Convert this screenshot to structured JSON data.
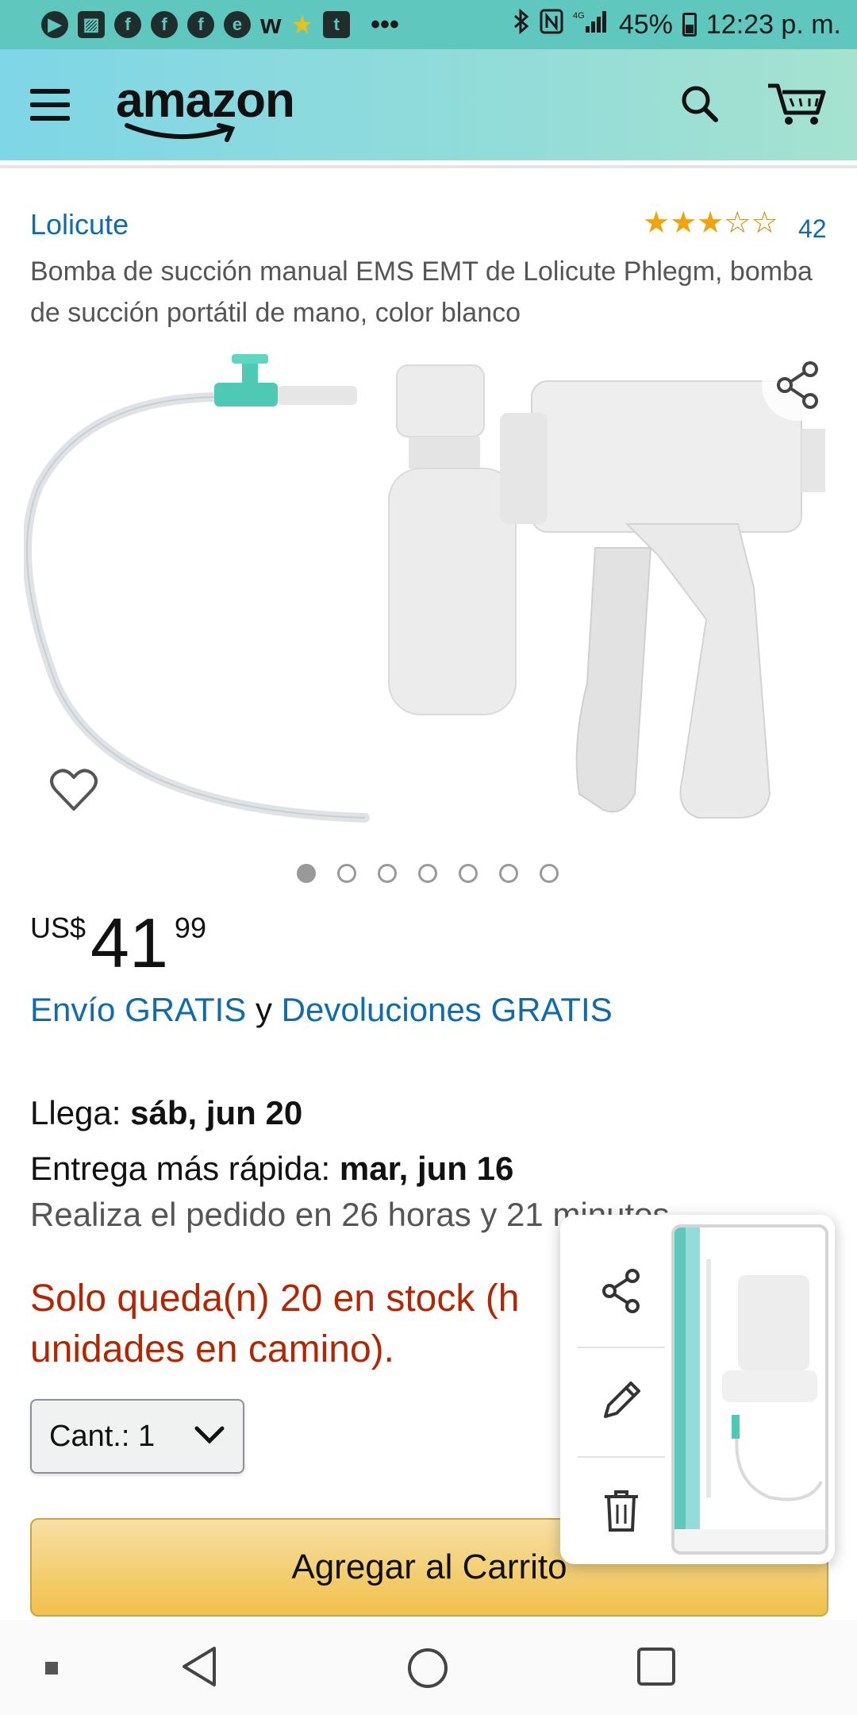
{
  "status_bar": {
    "app_icons": [
      "P",
      "img",
      "f",
      "f",
      "f",
      "e",
      "w",
      "star",
      "t"
    ],
    "more": "•••",
    "battery": "45%",
    "time": "12:23 p. m."
  },
  "header": {
    "logo": "amazon",
    "menu_icon": "hamburger-icon",
    "search_icon": "search-icon",
    "cart_icon": "cart-icon"
  },
  "product": {
    "brand": "Lolicute",
    "rating_stars": 3.5,
    "rating_count": "42",
    "title": "Bomba de succión manual EMS EMT de Lolicute Phlegm, bomba de succión portátil de mano, color blanco",
    "image_count": 7,
    "active_image": 1
  },
  "price": {
    "currency": "US$",
    "whole": "41",
    "fraction": "99"
  },
  "shipping": {
    "free_shipping": "Envío GRATIS",
    "connector": " y ",
    "free_returns": "Devoluciones GRATIS"
  },
  "delivery": {
    "arrive_label": "Llega: ",
    "arrive_date": "sáb, jun 20",
    "fastest_label": "Entrega más rápida: ",
    "fastest_date": "mar, jun 16",
    "order_within": "Realiza el pedido en 26 horas y 21 minutos"
  },
  "stock": {
    "line1": "Solo queda(n) 20 en stock (h",
    "line2": "unidades en camino)."
  },
  "quantity": {
    "label": "Cant.: ",
    "value": "1"
  },
  "cart_button": "Agregar al Carrito",
  "screenshot_panel": {
    "actions": [
      "share-icon",
      "edit-icon",
      "delete-icon"
    ]
  },
  "colors": {
    "status_bar": "#5fc7bd",
    "link": "#0f6caa",
    "stock_warning": "#b12704",
    "cart_button": "#f0c14b",
    "star": "#f0a311"
  }
}
